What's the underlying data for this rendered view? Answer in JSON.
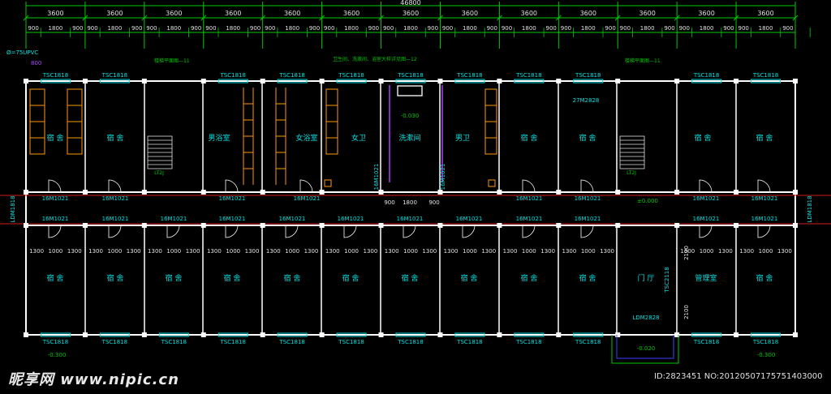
{
  "top": {
    "overall_dimension": "46800",
    "bay_dimensions": [
      "3600",
      "3600",
      "3600",
      "3600",
      "3600",
      "3600",
      "3600",
      "3600",
      "3600",
      "3600",
      "3600",
      "3600",
      "3600"
    ],
    "sub_dimensions": [
      "900",
      "1800",
      "900",
      "900",
      "1800",
      "900",
      "900",
      "1800",
      "900",
      "900",
      "1800",
      "900",
      "900",
      "1800",
      "900",
      "900",
      "1800",
      "900",
      "900",
      "1800",
      "900",
      "900",
      "1800",
      "900",
      "900",
      "1800",
      "900",
      "900",
      "1800",
      "900",
      "900",
      "1800",
      "900",
      "900",
      "1800",
      "900",
      "900",
      "1800",
      "900"
    ]
  },
  "rooms_north": [
    "宿 舍",
    "宿 舍",
    "男浴室",
    "女浴室",
    "女卫",
    "洗漱间",
    "男卫",
    "宿 舍",
    "宿 舍",
    "宿 舍",
    "宿 舍"
  ],
  "rooms_south": [
    "宿 舍",
    "宿 舍",
    "宿 舍",
    "宿 舍",
    "宿 舍",
    "宿 舍",
    "宿 舍",
    "宿 舍",
    "宿 舍",
    "宿 舍",
    "门 厅",
    "管理室",
    "宿 舍"
  ],
  "door_code": "16M1021",
  "window_code": "TSC1818",
  "corridor_dims": [
    "1300",
    "1000",
    "1300"
  ],
  "annotations": {
    "pipe_note": "Ø=75UPVC",
    "pipe_note2": "800",
    "stair_note_left": "楼梯平面图—11",
    "stair_note_right": "楼梯平面图—11",
    "toilet_note": "卫生间、洗漱间、浴室大样详见图—12",
    "level_wash": "-0.030",
    "level_hall": "±0.000",
    "level_out_left": "-0.300",
    "level_out_right": "-0.300",
    "level_entry": "-0.020",
    "stair_tag": "LT2J",
    "door_27": "27M2828",
    "ldm_left": "LDM1818",
    "ldm_right": "LDM1818",
    "ldm_entry": "LDM2828",
    "tsc_entry": "TSC2118",
    "dim_2100": "2100",
    "wash_dims": [
      "900",
      "1800",
      "900"
    ],
    "mid_door": "16M1021"
  },
  "watermark": {
    "site": "昵享网",
    "url": "www.nipic.cn",
    "id_line": "ID:2823451 NO:20120507175751403000"
  },
  "colors": {
    "wall": "#ffffff",
    "dimension": "#00c800",
    "text_cyan": "#00e0e0",
    "axis": "#d02020",
    "furniture": "#ff9a00",
    "fixture": "#b040ff"
  }
}
